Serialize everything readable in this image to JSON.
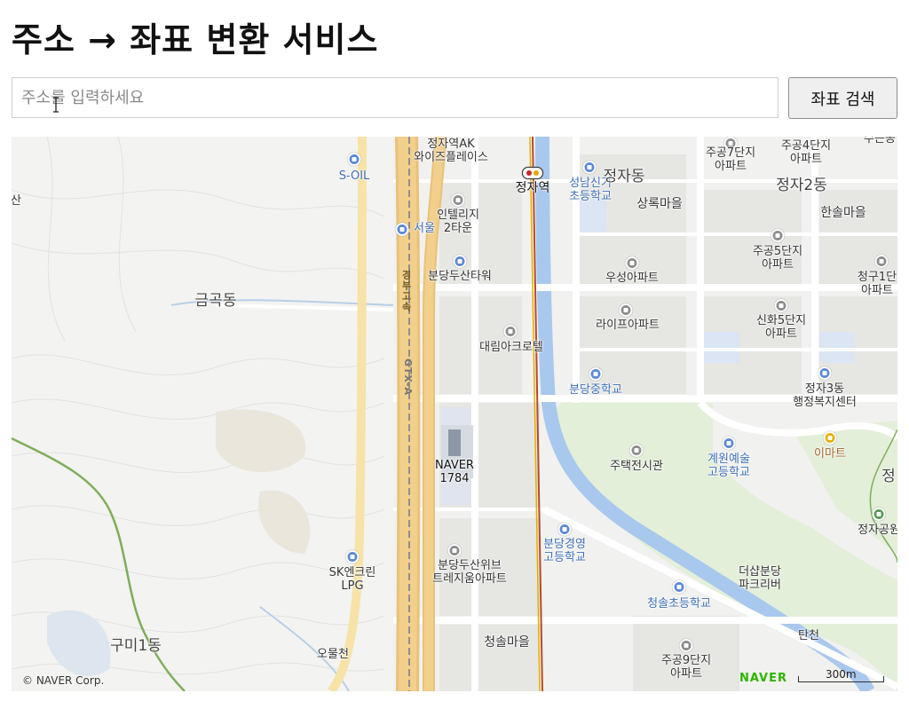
{
  "page": {
    "title": "주소 → 좌표 변환 서비스"
  },
  "search": {
    "placeholder": "주소를 입력하세요",
    "value": "",
    "button_label": "좌표 검색"
  },
  "map": {
    "copyright": "© NAVER Corp.",
    "brand": "NAVER",
    "scale_label": "300m",
    "colors": {
      "background": "#f6f6f4",
      "park": "#e3efd9",
      "water": "#a9c8ee",
      "highway": "#f2cf8a",
      "rail": "#8f8f8f",
      "subway": "#b44d2b",
      "road": "#ffffff",
      "block": "#ececea"
    },
    "labels": [
      {
        "id": "jeongja-ak",
        "text": "정자역AK\n와이즈플레이스",
        "style": "s"
      },
      {
        "id": "s-oil",
        "text": "S-OIL",
        "style": "s blue"
      },
      {
        "id": "jeongja-station",
        "text": "정자역",
        "style": "m dark"
      },
      {
        "id": "seongnam-school",
        "text": "성남신기\n초등학교",
        "style": "s blue"
      },
      {
        "id": "jeongja-dong",
        "text": "정자동",
        "style": "l"
      },
      {
        "id": "apt-7",
        "text": "주공7단지\n아파트",
        "style": "s"
      },
      {
        "id": "apt-4",
        "text": "주공4단지\n아파트",
        "style": "s"
      },
      {
        "id": "jeongja-2dong",
        "text": "정자2동",
        "style": "l"
      },
      {
        "id": "intellige",
        "text": "인텔리지\n2타운",
        "style": "s"
      },
      {
        "id": "seoul-tg",
        "text": "서울",
        "style": "s blue"
      },
      {
        "id": "sangnok",
        "text": "상록마을",
        "style": "m"
      },
      {
        "id": "hansol",
        "text": "한솔마을",
        "style": "m"
      },
      {
        "id": "apt-5",
        "text": "주공5단지\n아파트",
        "style": "s"
      },
      {
        "id": "cheonggu-1",
        "text": "청구1단\n아파트",
        "style": "s"
      },
      {
        "id": "bundang-dusan",
        "text": "분당두산타워",
        "style": "s"
      },
      {
        "id": "wooseong",
        "text": "우성아파트",
        "style": "s"
      },
      {
        "id": "geumgok",
        "text": "금곡동",
        "style": "l"
      },
      {
        "id": "life-apt",
        "text": "라이프아파트",
        "style": "s"
      },
      {
        "id": "sinhwa-5",
        "text": "신화5단지\n아파트",
        "style": "s"
      },
      {
        "id": "daelim",
        "text": "대림아크로텔",
        "style": "s"
      },
      {
        "id": "bundang-middle",
        "text": "분당중학교",
        "style": "s blue"
      },
      {
        "id": "jeongja-3dong",
        "text": "정자3동\n행정복지센터",
        "style": "s"
      },
      {
        "id": "naver-1784",
        "text": "NAVER\n1784",
        "style": "s dark"
      },
      {
        "id": "jutaek",
        "text": "주택전시관",
        "style": "s"
      },
      {
        "id": "gyewon",
        "text": "계원예술\n고등학교",
        "style": "s blue"
      },
      {
        "id": "emart",
        "text": "이마트",
        "style": "s brand"
      },
      {
        "id": "jeongja-park",
        "text": "정자공원",
        "style": "s"
      },
      {
        "id": "bundang-high",
        "text": "분당경영\n고등학교",
        "style": "s blue"
      },
      {
        "id": "sk-lpg",
        "text": "SK엔크린\nLPG",
        "style": "s"
      },
      {
        "id": "dusan-we",
        "text": "분당두산위브\n트레지움아파트",
        "style": "s"
      },
      {
        "id": "deosap",
        "text": "더샵분당\n파크리버",
        "style": "s"
      },
      {
        "id": "cheongsol-school",
        "text": "청솔초등학교",
        "style": "s blue"
      },
      {
        "id": "cheongsol",
        "text": "청솔마을",
        "style": "m"
      },
      {
        "id": "guminil",
        "text": "구미1동",
        "style": "l"
      },
      {
        "id": "omulcheon",
        "text": "오물천",
        "style": "s"
      },
      {
        "id": "apt-9",
        "text": "주공9단지\n아파트",
        "style": "s"
      },
      {
        "id": "tancheon",
        "text": "탄천",
        "style": "s"
      },
      {
        "id": "san-left",
        "text": "산",
        "style": "s"
      },
      {
        "id": "jeong-right",
        "text": "정",
        "style": "l"
      },
      {
        "id": "seonghwan",
        "text": "수는공",
        "style": "s"
      }
    ],
    "road_signs": [
      {
        "id": "gyeongbu",
        "text": "경부고속"
      },
      {
        "id": "gtx",
        "text": "GTX-A"
      }
    ]
  }
}
